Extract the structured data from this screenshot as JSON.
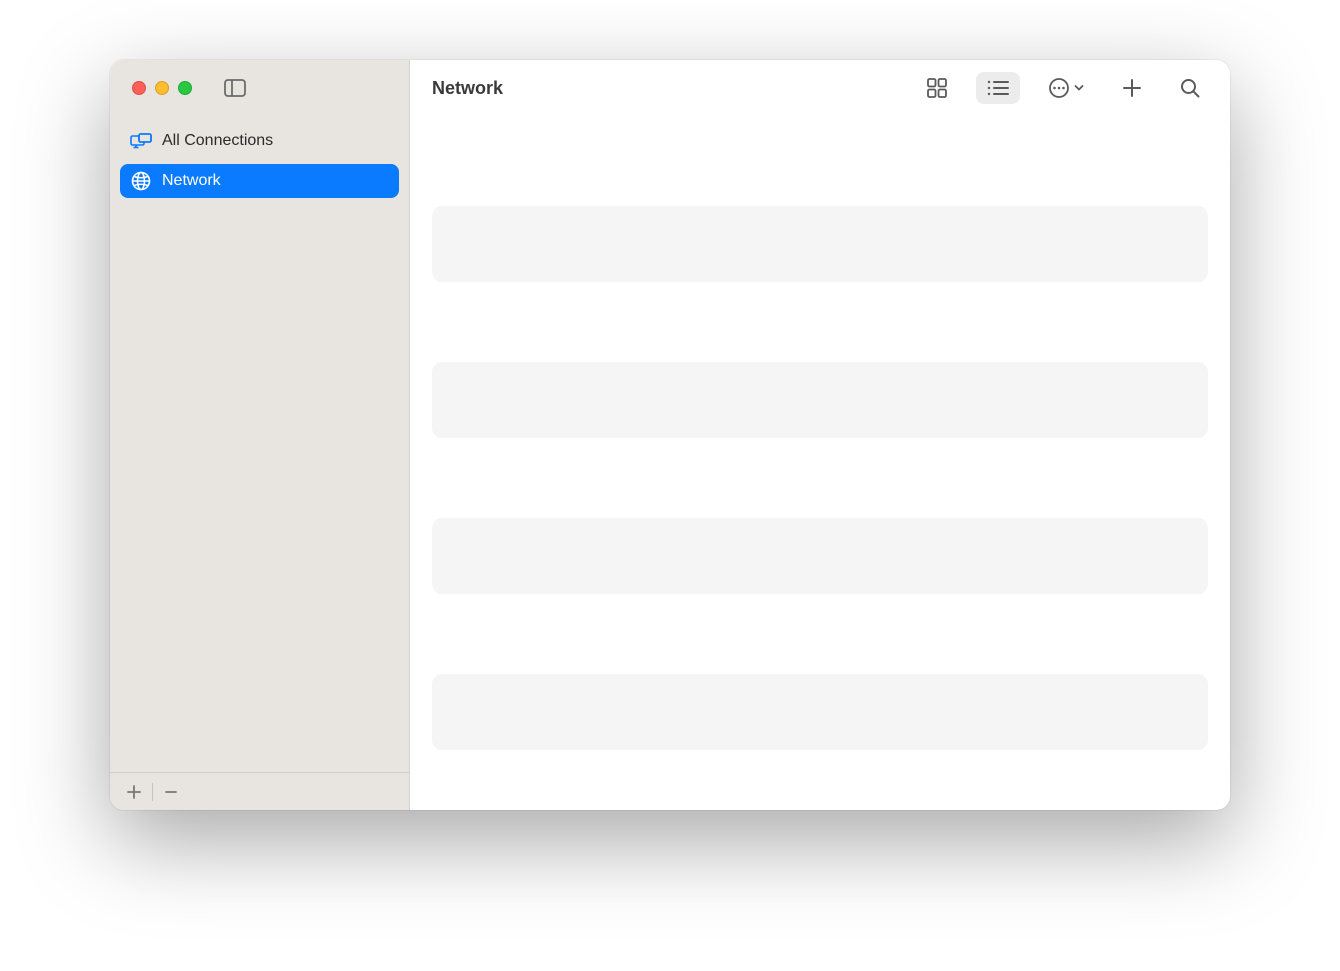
{
  "header": {
    "title": "Network"
  },
  "sidebar": {
    "items": [
      {
        "label": "All Connections",
        "icon": "displays-icon",
        "active": false
      },
      {
        "label": "Network",
        "icon": "globe-icon",
        "active": true
      }
    ]
  },
  "toolbar": {
    "view_grid": "grid",
    "view_list": "list",
    "more": "more",
    "add": "add",
    "search": "search"
  }
}
